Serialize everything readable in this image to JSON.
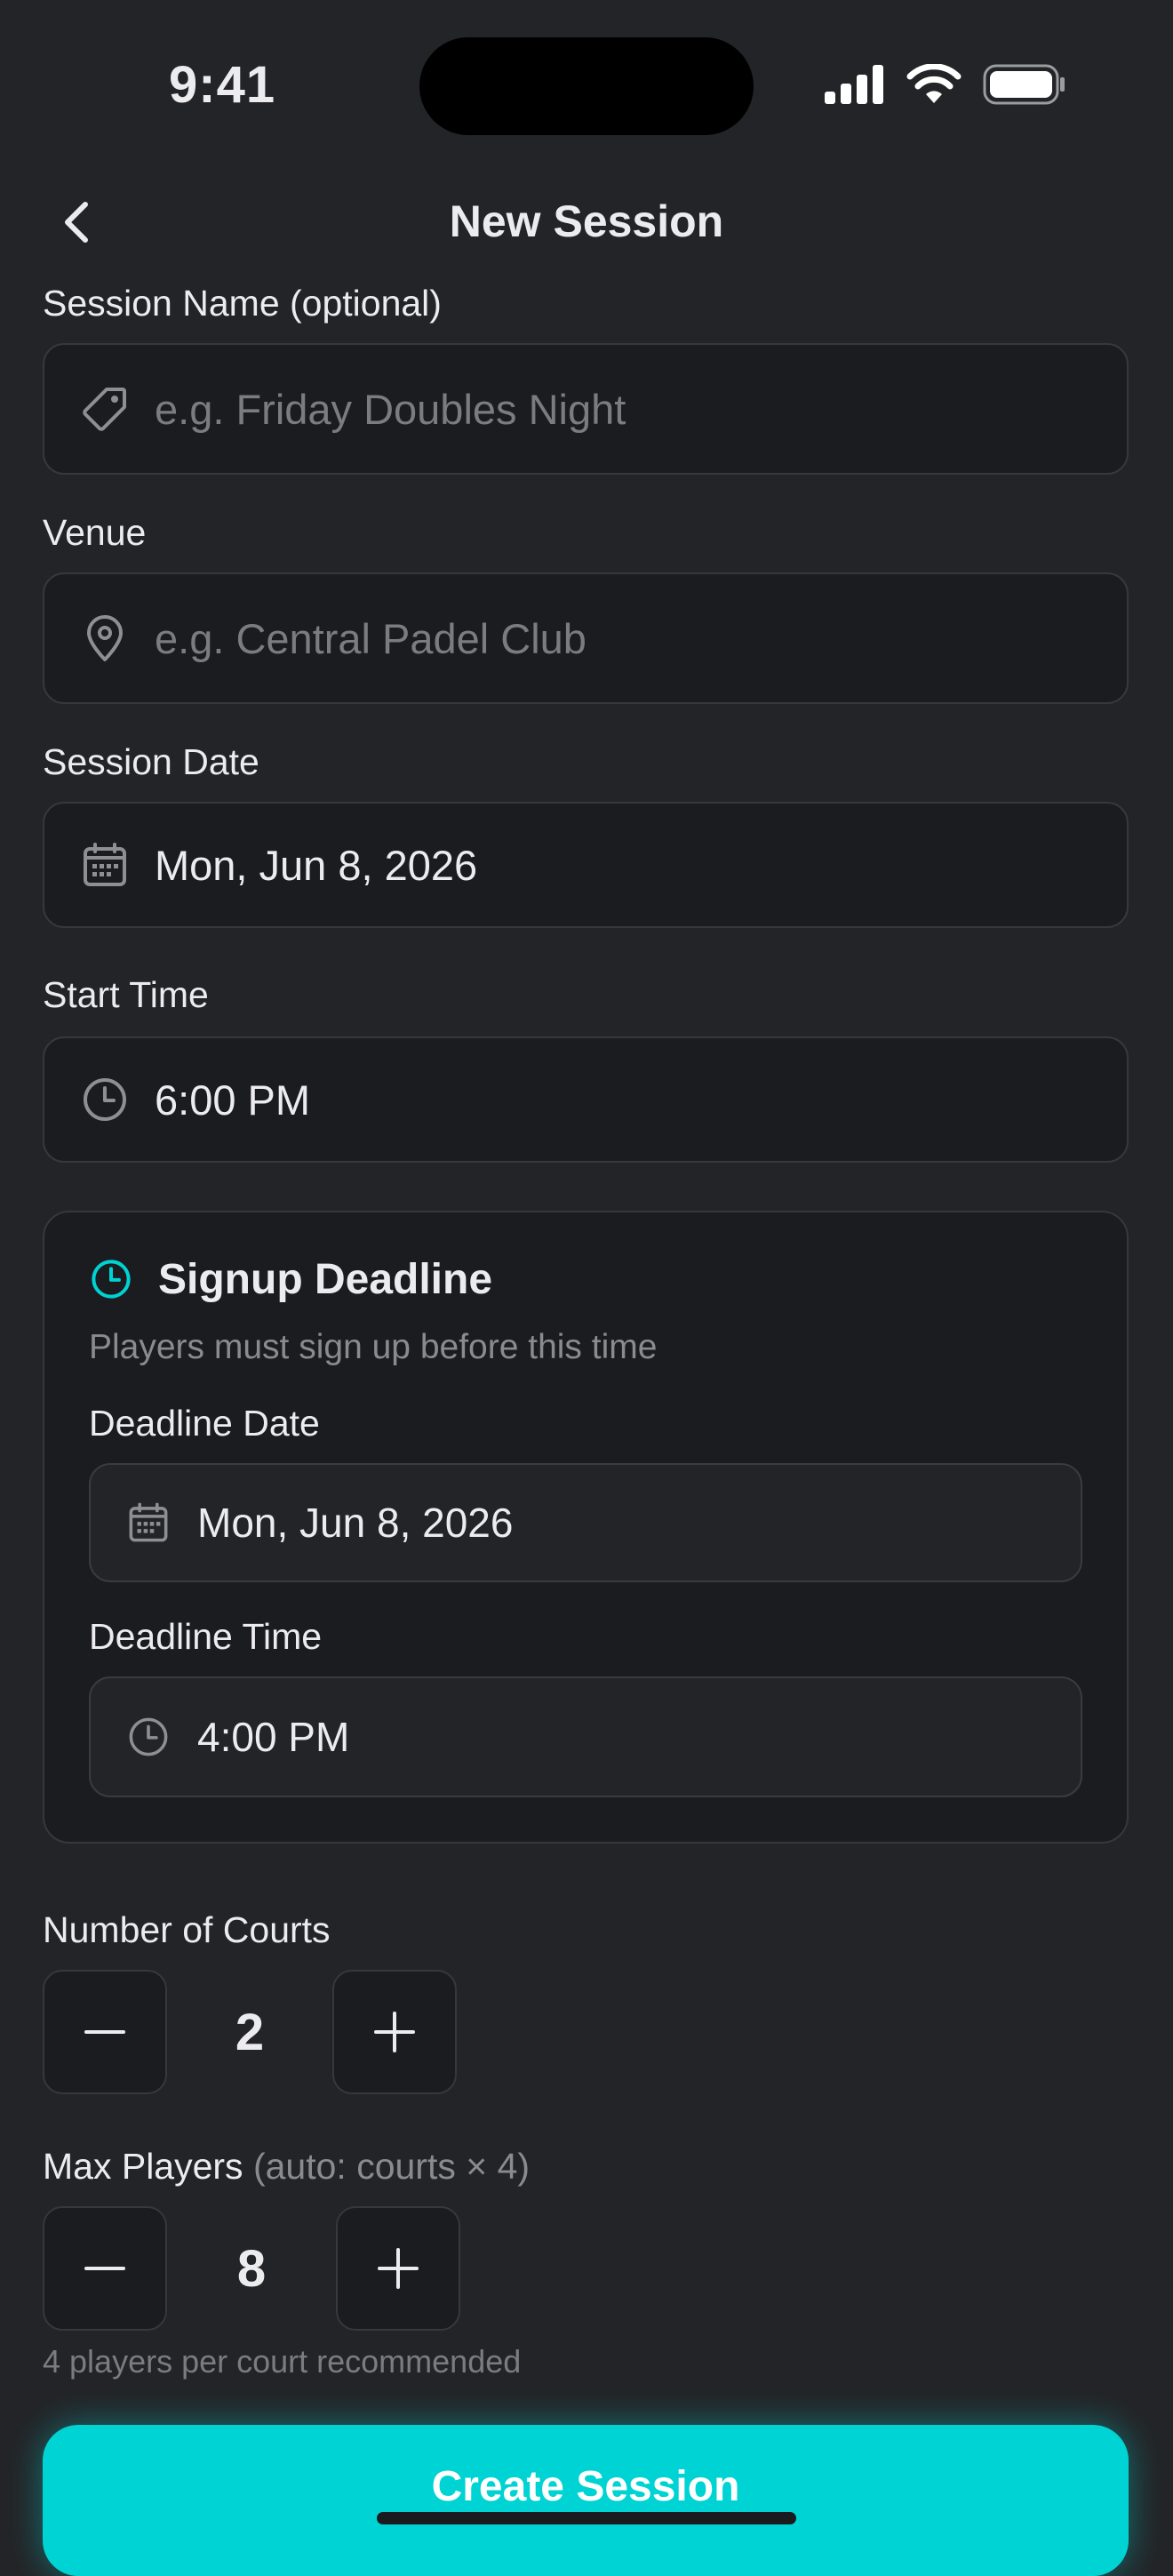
{
  "status_bar": {
    "time": "9:41"
  },
  "header": {
    "title": "New Session"
  },
  "form": {
    "session_name": {
      "label": "Session Name (optional)",
      "placeholder": "e.g. Friday Doubles Night"
    },
    "venue": {
      "label": "Venue",
      "placeholder": "e.g. Central Padel Club"
    },
    "session_date": {
      "label": "Session Date",
      "value": "Mon, Jun 8, 2026"
    },
    "start_time": {
      "label": "Start Time",
      "value": "6:00 PM"
    },
    "signup_deadline": {
      "title": "Signup Deadline",
      "subtitle": "Players must sign up before this time",
      "date_label": "Deadline Date",
      "date_value": "Mon, Jun 8, 2026",
      "time_label": "Deadline Time",
      "time_value": "4:00 PM"
    },
    "courts": {
      "label": "Number of Courts",
      "value": "2",
      "minus": "−",
      "plus": "+"
    },
    "max_players": {
      "label": "Max Players",
      "hint": "(auto: courts × 4)",
      "value": "8",
      "note": "4 players per court recommended",
      "minus": "−",
      "plus": "+"
    }
  },
  "submit": {
    "label": "Create Session"
  },
  "colors": {
    "accent": "#00D3D3",
    "background": "#232427",
    "field": "#1B1C1F"
  }
}
